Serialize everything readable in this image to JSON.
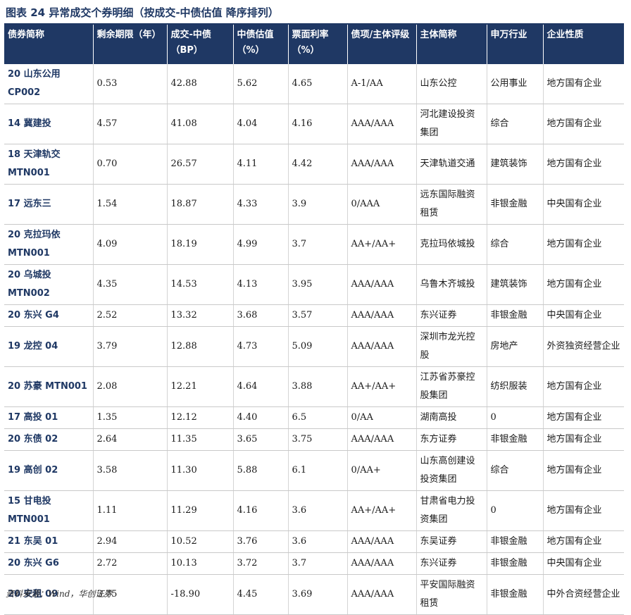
{
  "title": "图表 24   异常成交个券明细（按成交-中债估值 降序排列）",
  "headers": [
    "债券简称",
    "剩余期限（年）",
    "成交-中债（BP）",
    "中债估值（%）",
    "票面利率（%）",
    "债项/主体评级",
    "主体简称",
    "申万行业",
    "企业性质"
  ],
  "rows": [
    [
      "20 山东公用 CP002",
      "0.53",
      "42.88",
      "5.62",
      "4.65",
      "A-1/AA",
      "山东公控",
      "公用事业",
      "地方国有企业"
    ],
    [
      "14 冀建投",
      "4.57",
      "41.08",
      "4.04",
      "4.16",
      "AAA/AAA",
      "河北建设投资集团",
      "综合",
      "地方国有企业"
    ],
    [
      "18 天津轨交 MTN001",
      "0.70",
      "26.57",
      "4.11",
      "4.42",
      "AAA/AAA",
      "天津轨道交通",
      "建筑装饰",
      "地方国有企业"
    ],
    [
      "17 远东三",
      "1.54",
      "18.87",
      "4.33",
      "3.9",
      "0/AAA",
      "远东国际融资租赁",
      "非银金融",
      "中央国有企业"
    ],
    [
      "20 克拉玛依 MTN001",
      "4.09",
      "18.19",
      "4.99",
      "3.7",
      "AA+/AA+",
      "克拉玛依城投",
      "综合",
      "地方国有企业"
    ],
    [
      "20 乌城投 MTN002",
      "4.35",
      "14.53",
      "4.13",
      "3.95",
      "AAA/AAA",
      "乌鲁木齐城投",
      "建筑装饰",
      "地方国有企业"
    ],
    [
      "20 东兴 G4",
      "2.52",
      "13.32",
      "3.68",
      "3.57",
      "AAA/AAA",
      "东兴证券",
      "非银金融",
      "中央国有企业"
    ],
    [
      "19 龙控 04",
      "3.79",
      "12.88",
      "4.73",
      "5.09",
      "AAA/AAA",
      "深圳市龙光控股",
      "房地产",
      "外资独资经营企业"
    ],
    [
      "20 苏豪 MTN001",
      "2.08",
      "12.21",
      "4.64",
      "3.88",
      "AA+/AA+",
      "江苏省苏豪控股集团",
      "纺织服装",
      "地方国有企业"
    ],
    [
      "17 高投 01",
      "1.35",
      "12.12",
      "4.40",
      "6.5",
      "0/AA",
      "湖南高投",
      "0",
      "地方国有企业"
    ],
    [
      "20 东债 02",
      "2.64",
      "11.35",
      "3.65",
      "3.75",
      "AAA/AAA",
      "东方证券",
      "非银金融",
      "地方国有企业"
    ],
    [
      "19 高创 02",
      "3.58",
      "11.30",
      "5.88",
      "6.1",
      "0/AA+",
      "山东高创建设投资集团",
      "综合",
      "地方国有企业"
    ],
    [
      "15 甘电投 MTN001",
      "1.11",
      "11.29",
      "4.16",
      "3.6",
      "AA+/AA+",
      "甘肃省电力投资集团",
      "0",
      "地方国有企业"
    ],
    [
      "21 东吴 01",
      "2.94",
      "10.52",
      "3.76",
      "3.6",
      "AAA/AAA",
      "东吴证券",
      "非银金融",
      "地方国有企业"
    ],
    [
      "20 东兴 G6",
      "2.72",
      "10.13",
      "3.72",
      "3.7",
      "AAA/AAA",
      "东兴证券",
      "非银金融",
      "中央国有企业"
    ],
    [
      "20 安租 09",
      "3.75",
      "-18.90",
      "4.45",
      "3.69",
      "AAA/AAA",
      "平安国际融资租赁",
      "非银金融",
      "中外合资经营企业"
    ]
  ],
  "source": "资料来源：Wind，华创证券"
}
